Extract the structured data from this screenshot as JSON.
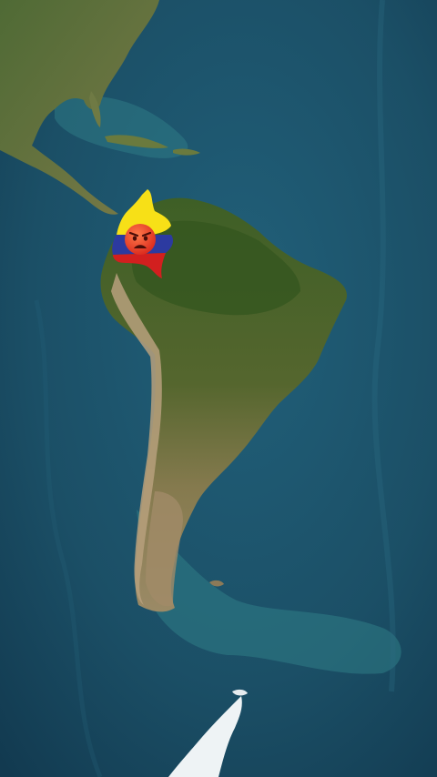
{
  "map": {
    "view": "satellite",
    "region": "South America",
    "colors": {
      "ocean_deep": "#173f57",
      "ocean_mid": "#1f5a70",
      "ocean_shallow": "#3a8c93",
      "rainforest": "#3a5a22",
      "savanna": "#7a7a3a",
      "desert": "#9a8460",
      "mountains": "#b49c7a",
      "ice": "#f2f5f7"
    },
    "highlighted_country": {
      "flag_colors": [
        "#f7e017",
        "#2c3aa0",
        "#d21f1f"
      ],
      "emoji": "angry-face"
    }
  }
}
